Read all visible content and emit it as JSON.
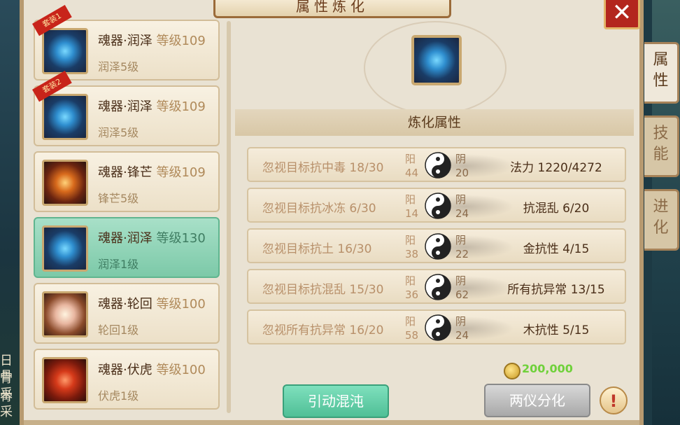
{
  "window": {
    "title": "属性炼化",
    "close_label": "✕"
  },
  "side_tabs": [
    {
      "label": "属\n性",
      "active": true
    },
    {
      "label": "技\n能",
      "active": false
    },
    {
      "label": "进\n化",
      "active": false
    }
  ],
  "background_text": [
    "日骨",
    "骨采",
    "骨采"
  ],
  "items": [
    {
      "name": "魂器·润泽",
      "level": "等级109",
      "sub": "润泽5级",
      "icon": "blue-soul-icon",
      "ribbon": "套装1",
      "selected": false
    },
    {
      "name": "魂器·润泽",
      "level": "等级109",
      "sub": "润泽5级",
      "icon": "blue-soul-icon",
      "ribbon": "套装2",
      "selected": false
    },
    {
      "name": "魂器·锋芒",
      "level": "等级109",
      "sub": "锋芒5级",
      "icon": "fire-ring-icon",
      "ribbon": "",
      "selected": false
    },
    {
      "name": "魂器·润泽",
      "level": "等级130",
      "sub": "润泽1级",
      "icon": "blue-soul-icon",
      "ribbon": "",
      "selected": true
    },
    {
      "name": "魂器·轮回",
      "level": "等级100",
      "sub": "轮回1级",
      "icon": "pearl-icon",
      "ribbon": "",
      "selected": false
    },
    {
      "name": "魂器·伏虎",
      "level": "等级100",
      "sub": "伏虎1级",
      "icon": "tiger-flame-icon",
      "ribbon": "",
      "selected": false
    }
  ],
  "section_title": "炼化属性",
  "yang_label": "阳",
  "yin_label": "阴",
  "rows": [
    {
      "left": "忽视目标抗中毒 18/30",
      "yang": "44",
      "yin": "20",
      "right": "法力 1220/4272"
    },
    {
      "left": "忽视目标抗冰冻 6/30",
      "yang": "14",
      "yin": "24",
      "right": "抗混乱 6/20"
    },
    {
      "left": "忽视目标抗土 16/30",
      "yang": "38",
      "yin": "22",
      "right": "金抗性 4/15"
    },
    {
      "left": "忽视目标抗混乱 15/30",
      "yang": "36",
      "yin": "62",
      "right": "所有抗异常 13/15"
    },
    {
      "left": "忽视所有抗异常 16/20",
      "yang": "58",
      "yin": "24",
      "right": "木抗性 5/15"
    }
  ],
  "cost": "200,000",
  "buttons": {
    "activate": "引动混沌",
    "split": "两仪分化",
    "info": "!"
  },
  "colors": {
    "accent_green": "#4fbf96",
    "title_brown": "#6b3c1c",
    "coin_green": "#6fd13a"
  }
}
